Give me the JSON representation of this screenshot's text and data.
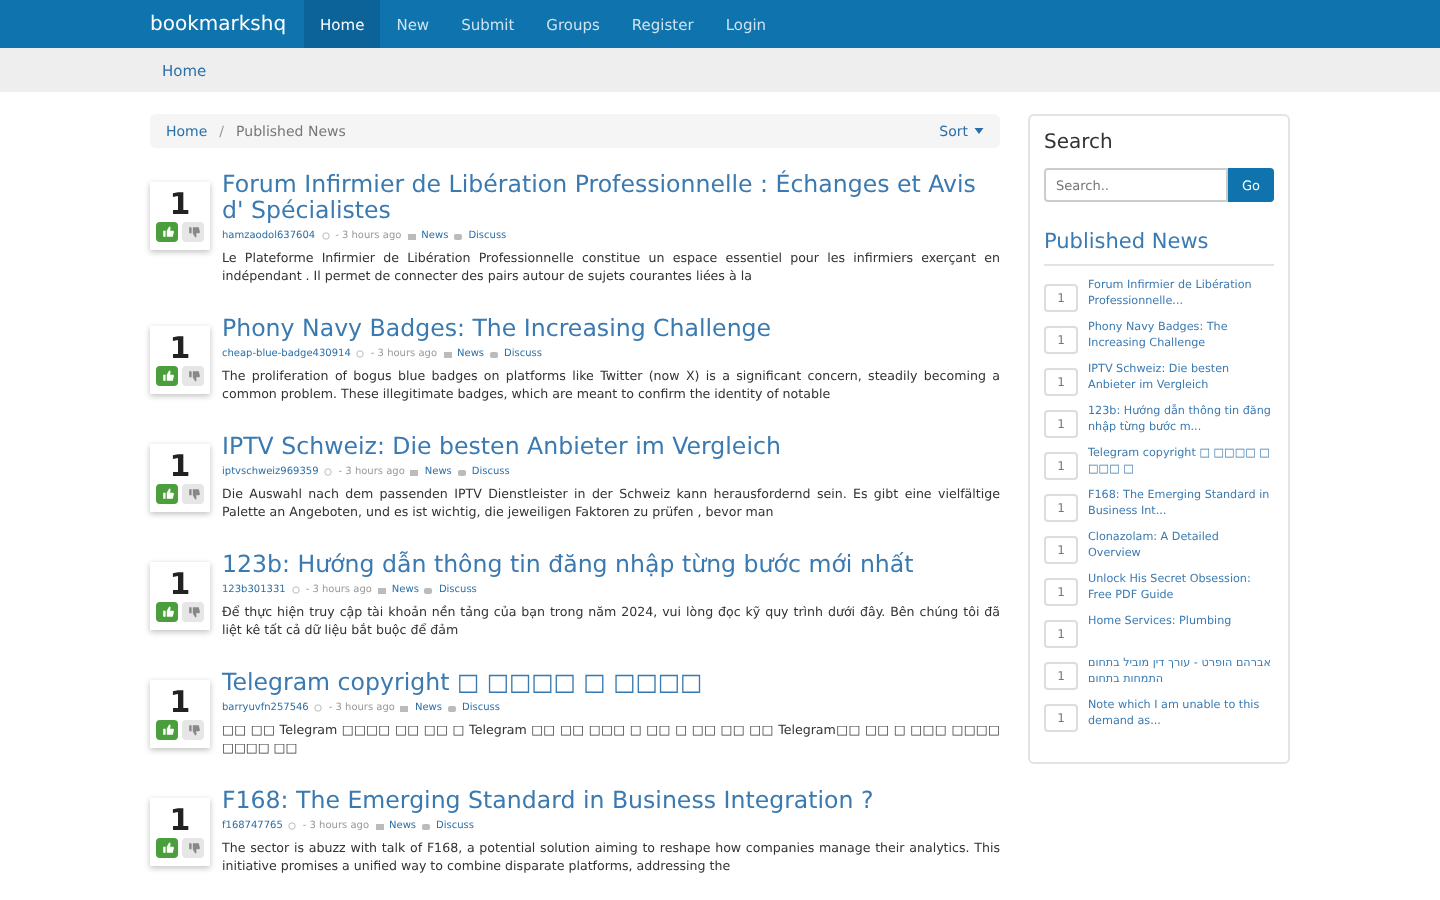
{
  "navbar": {
    "brand": "bookmarkshq",
    "items": [
      {
        "label": "Home",
        "selected": true
      },
      {
        "label": "New",
        "selected": false
      },
      {
        "label": "Submit",
        "selected": false
      },
      {
        "label": "Groups",
        "selected": false
      },
      {
        "label": "Register",
        "selected": false
      },
      {
        "label": "Login",
        "selected": false
      }
    ]
  },
  "subnav": {
    "label": "Home"
  },
  "breadcrumb": {
    "items": [
      "Home",
      "Published News"
    ],
    "separator": "/",
    "sort": "Sort"
  },
  "posts": [
    {
      "votes": "1",
      "title": "Forum Infirmier de Libération Professionnelle : Échanges et Avis d' Spécialistes",
      "author": "hamzaodol637604",
      "time": "- 3 hours ago",
      "category": "News",
      "discuss": "Discuss",
      "text": "Le Plateforme Infirmier de Libération Professionnelle constitue un espace essentiel pour les infirmiers exerçant en indépendant . Il permet de connecter des pairs autour de sujets courantes liées à la"
    },
    {
      "votes": "1",
      "title": "Phony Navy Badges: The Increasing Challenge",
      "author": "cheap-blue-badge430914",
      "time": "- 3 hours ago",
      "category": "News",
      "discuss": "Discuss",
      "text": "The proliferation of bogus blue badges on platforms like Twitter (now X) is a significant concern, steadily becoming a common problem. These illegitimate badges, which are meant to confirm the identity of notable"
    },
    {
      "votes": "1",
      "title": "IPTV Schweiz: Die besten Anbieter im Vergleich",
      "author": "iptvschweiz969359",
      "time": "- 3 hours ago",
      "category": "News",
      "discuss": "Discuss",
      "text": "Die Auswahl nach dem passenden IPTV Dienstleister in der Schweiz kann herausfordernd sein. Es gibt eine vielfältige Palette an Angeboten, und es ist wichtig, die jeweiligen Faktoren zu prüfen , bevor man"
    },
    {
      "votes": "1",
      "title": "123b: Hướng dẫn thông tin đăng nhập từng bước mới nhất",
      "author": "123b301331",
      "time": "- 3 hours ago",
      "category": "News",
      "discuss": "Discuss",
      "text": "Để thực hiện truy cập tài khoản nền tảng của bạn trong năm 2024, vui lòng đọc kỹ quy trình dưới đây. Bên chúng tôi đã liệt kê tất cả dữ liệu bắt buộc để đảm"
    },
    {
      "votes": "1",
      "title": "Telegram copyright □ □□□□ □ □□□□",
      "author": "barryuvfn257546",
      "time": "- 3 hours ago",
      "category": "News",
      "discuss": "Discuss",
      "text": "□□ □□ Telegram □□□□ □□ □□ □ Telegram □□ □□ □□□ □ □□ □ □□ □□ □□ Telegram□□ □□ □ □□□ □□□□ □□□□ □□"
    },
    {
      "votes": "1",
      "title": "F168: The Emerging Standard in Business Integration ?",
      "author": "f168747765",
      "time": "- 3 hours ago",
      "category": "News",
      "discuss": "Discuss",
      "text": "The sector is abuzz with talk of F168, a potential solution aiming to reshape how companies manage their analytics. This initiative promises a unified way to combine disparate platforms, addressing the"
    }
  ],
  "sidebar": {
    "search_title": "Search",
    "search_placeholder": "Search..",
    "search_button": "Go",
    "news_title": "Published News",
    "news": [
      {
        "count": "1",
        "title": "Forum Infirmier de Libération Professionnelle..."
      },
      {
        "count": "1",
        "title": "Phony Navy Badges: The Increasing Challenge"
      },
      {
        "count": "1",
        "title": "IPTV Schweiz: Die besten Anbieter im Vergleich"
      },
      {
        "count": "1",
        "title": "123b: Hướng dẫn thông tin đăng nhập từng bước m..."
      },
      {
        "count": "1",
        "title": "Telegram copyright □ □□□□ □ □□□ □"
      },
      {
        "count": "1",
        "title": "F168: The Emerging Standard in Business Int..."
      },
      {
        "count": "1",
        "title": "Clonazolam: A Detailed Overview"
      },
      {
        "count": "1",
        "title": "Unlock His Secret Obsession: Free PDF Guide"
      },
      {
        "count": "1",
        "title": "Home Services: Plumbing"
      },
      {
        "count": "1",
        "title": "אברהם הופרט - עורך דין מוביל בתחום התמחות בתחום"
      },
      {
        "count": "1",
        "title": "Note which I am unable to this demand as..."
      }
    ]
  }
}
